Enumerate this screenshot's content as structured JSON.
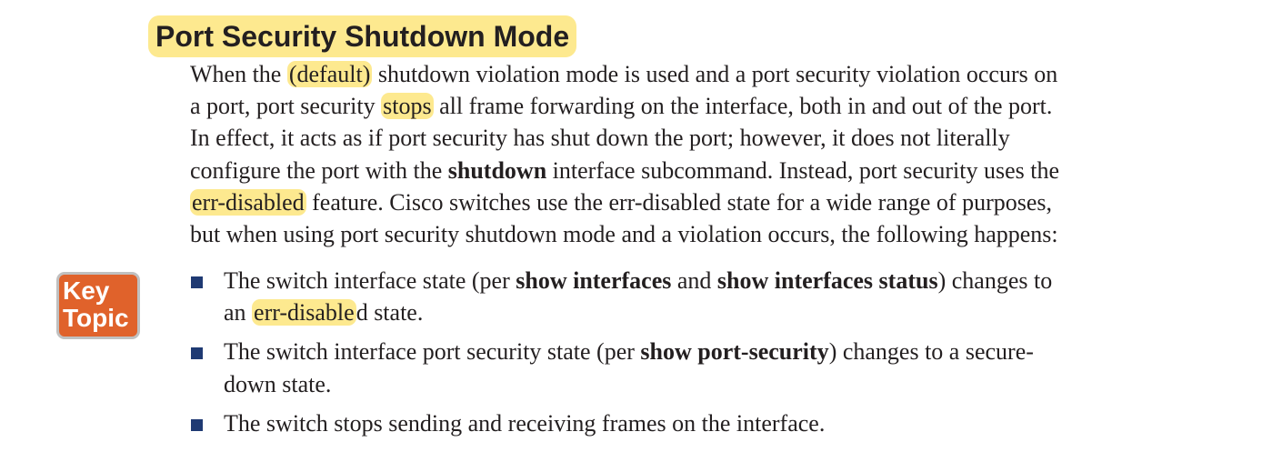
{
  "heading": "Port Security Shutdown Mode",
  "paragraph": {
    "l1_a": "When the ",
    "l1_hl": "(default)",
    "l1_b": " shutdown violation mode is used and a port security violation occurs on",
    "l2_a": "a port, port security ",
    "l2_hl": "stops",
    "l2_b": " all frame forwarding on the interface, both in and out of the port.",
    "l3": "In effect, it acts as if port security has shut down the port; however, it does not literally",
    "l4_a": "configure the port with the ",
    "l4_bold": "shutdown",
    "l4_b": " interface subcommand. Instead, port security uses the",
    "l5_hl": "err-disabled",
    "l5_b": " feature. Cisco switches use the err-disabled state for a wide range of purposes,",
    "l6": "but when using port security shutdown mode and a violation occurs, the following happens:"
  },
  "key_topic": {
    "line1": "Key",
    "line2": "Topic",
    "color": "#e0622b"
  },
  "bullets": {
    "b1_a": "The switch interface state (per ",
    "b1_bold1": "show interfaces",
    "b1_b": " and ",
    "b1_bold2": "show interfaces status",
    "b1_c": ") changes to",
    "b1_l2_a": "an ",
    "b1_l2_hl": "err-disable",
    "b1_l2_b": "d state.",
    "b2_a": "The switch interface port security state (per ",
    "b2_bold": "show port-security",
    "b2_b": ") changes to a secure-",
    "b2_l2": "down state.",
    "b3": "The switch stops sending and receiving frames on the interface."
  },
  "colors": {
    "highlight": "#fde98f",
    "bullet": "#1f3a73",
    "text": "#231f20"
  }
}
